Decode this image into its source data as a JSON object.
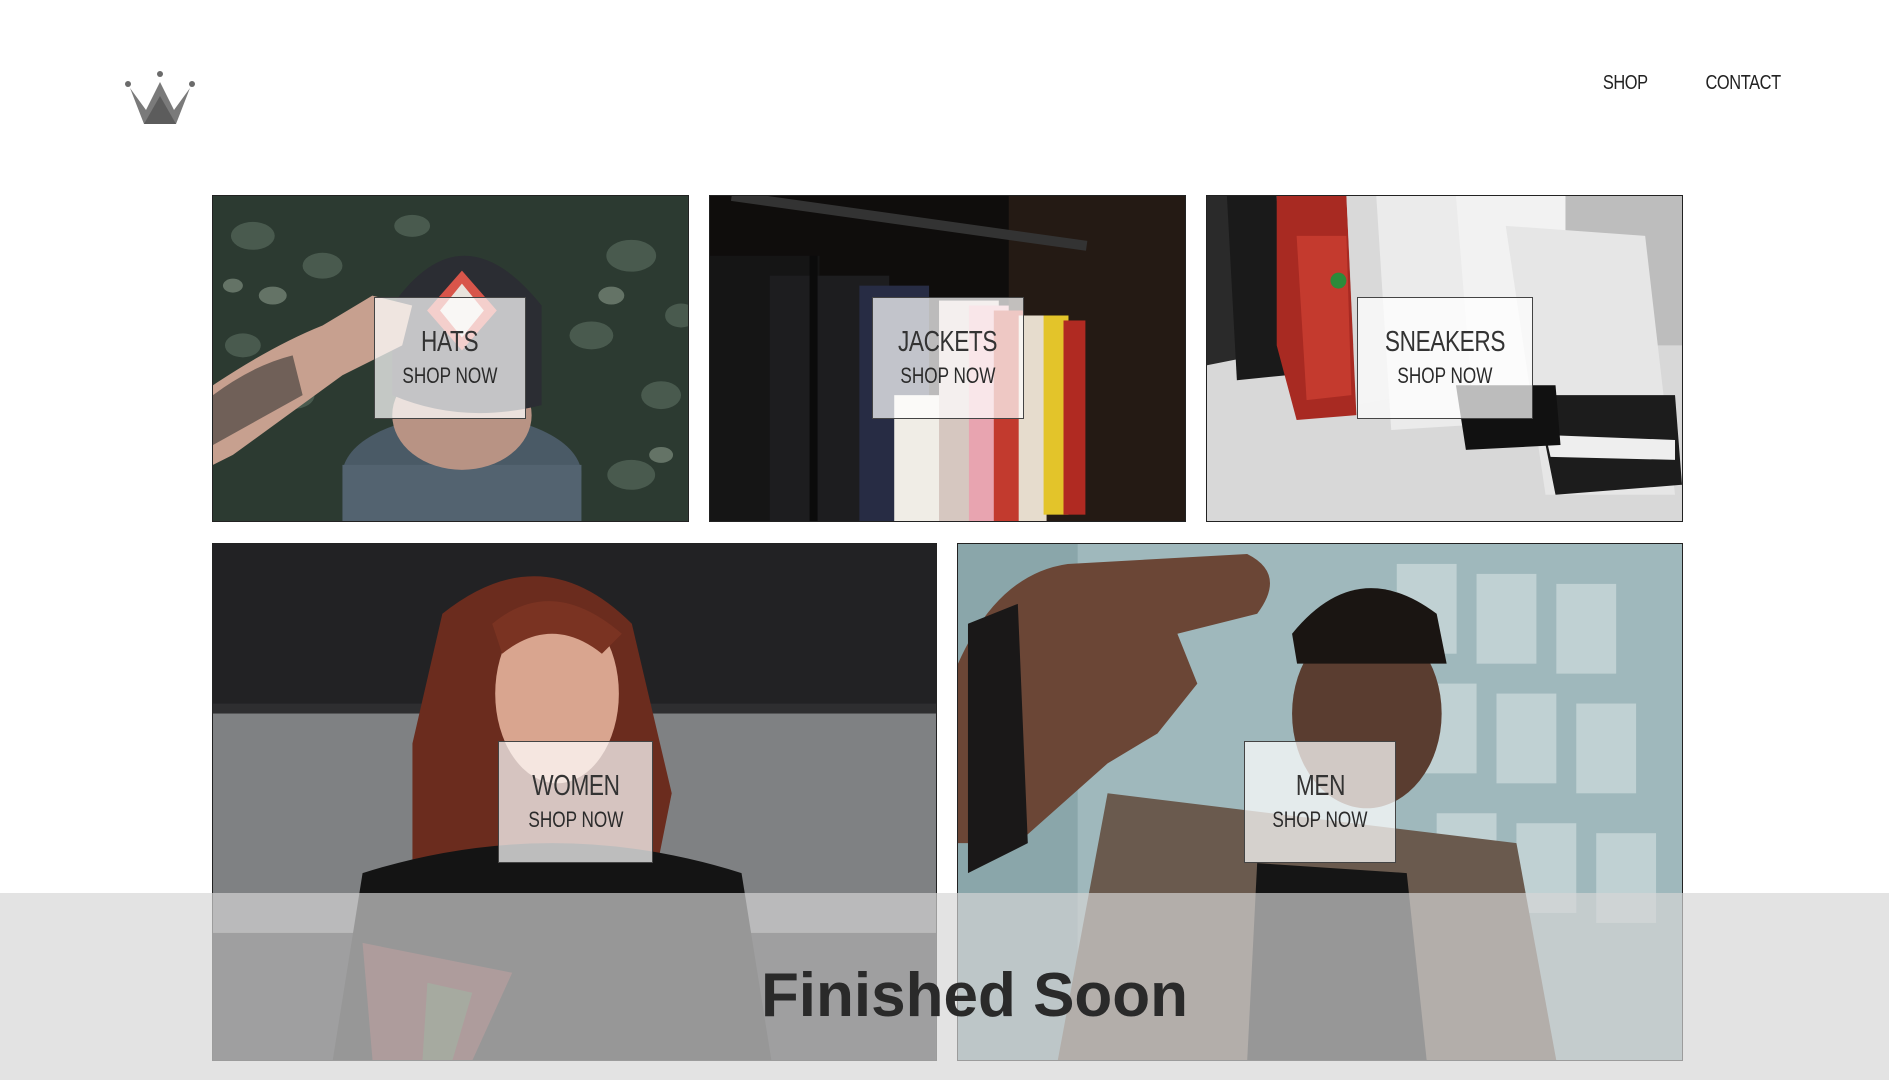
{
  "header": {
    "logo": "crown-icon",
    "nav": [
      {
        "label": "SHOP"
      },
      {
        "label": "CONTACT"
      }
    ]
  },
  "categories": [
    {
      "title": "HATS",
      "cta": "SHOP NOW"
    },
    {
      "title": "JACKETS",
      "cta": "SHOP NOW"
    },
    {
      "title": "SNEAKERS",
      "cta": "SHOP NOW"
    },
    {
      "title": "WOMEN",
      "cta": "SHOP NOW"
    },
    {
      "title": "MEN",
      "cta": "SHOP NOW"
    }
  ],
  "overlay": {
    "text": "Finished Soon"
  }
}
